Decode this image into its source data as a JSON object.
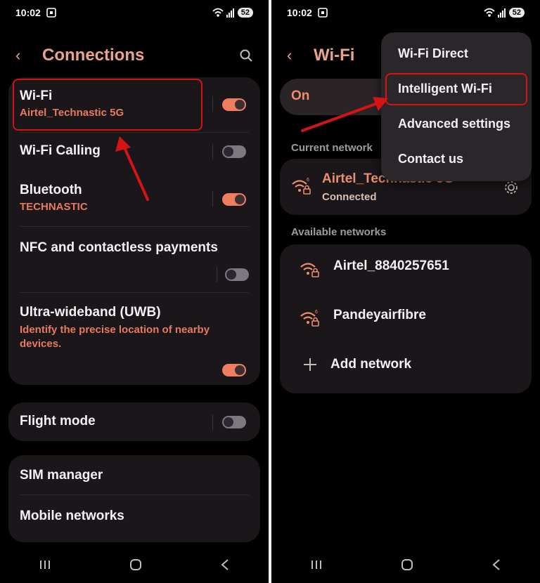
{
  "left": {
    "status": {
      "time": "10:02",
      "battery": "52"
    },
    "header": {
      "title": "Connections"
    },
    "items": {
      "wifi": {
        "title": "Wi-Fi",
        "subtitle": "Airtel_Technastic 5G",
        "state": "on"
      },
      "wifi_calling": {
        "title": "Wi-Fi Calling",
        "state": "off"
      },
      "bluetooth": {
        "title": "Bluetooth",
        "subtitle": "TECHNASTIC",
        "state": "on"
      },
      "nfc": {
        "title": "NFC and contactless payments",
        "state": "off"
      },
      "uwb": {
        "title": "Ultra-wideband (UWB)",
        "description": "Identify the precise location of nearby devices.",
        "state": "on"
      },
      "flight": {
        "title": "Flight mode",
        "state": "off"
      },
      "sim": {
        "title": "SIM manager"
      },
      "mobile": {
        "title": "Mobile networks"
      }
    }
  },
  "right": {
    "status": {
      "time": "10:02",
      "battery": "52"
    },
    "header": {
      "title": "Wi-Fi"
    },
    "toggle_label": "On",
    "current_label": "Current network",
    "current_network": {
      "name": "Airtel_Technastic 5G",
      "status": "Connected"
    },
    "available_label": "Available networks",
    "networks": [
      {
        "name": "Airtel_8840257651"
      },
      {
        "name": "Pandeyairfibre"
      }
    ],
    "add_network": "Add network",
    "menu": [
      "Wi-Fi Direct",
      "Intelligent Wi-Fi",
      "Advanced settings",
      "Contact us"
    ]
  },
  "colors": {
    "accent": "#ee7e5f",
    "highlight": "#d41414",
    "card": "#1a1619"
  }
}
